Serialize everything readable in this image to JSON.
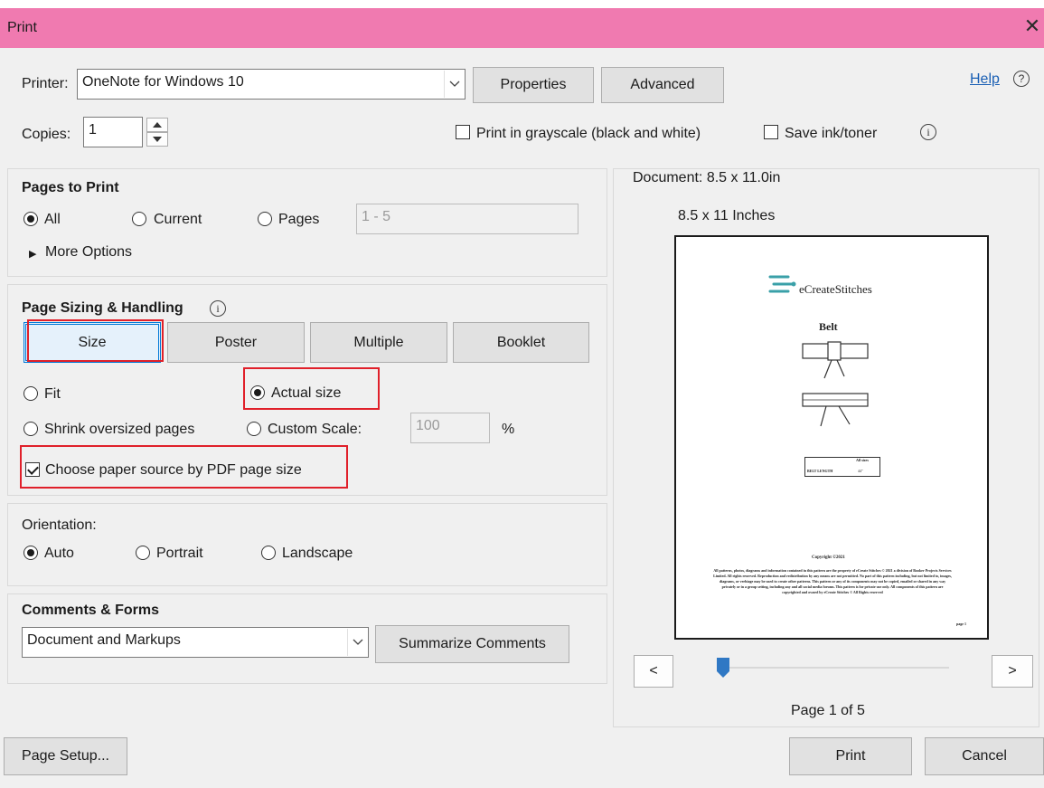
{
  "window": {
    "title": "Print",
    "close": "✕"
  },
  "top": {
    "printer_label": "Printer:",
    "printer_value": "OneNote for Windows 10",
    "properties": "Properties",
    "advanced": "Advanced",
    "help": "Help",
    "copies_label": "Copies:",
    "copies_value": "1",
    "grayscale_label": "Print in grayscale (black and white)",
    "grayscale_checked": false,
    "save_ink_label": "Save ink/toner",
    "save_ink_checked": false
  },
  "pages_to_print": {
    "heading": "Pages to Print",
    "all": "All",
    "current": "Current",
    "pages": "Pages",
    "selected": "All",
    "pages_range": "1 - 5",
    "more_options": "More Options"
  },
  "sizing": {
    "heading": "Page Sizing & Handling",
    "tabs": [
      "Size",
      "Poster",
      "Multiple",
      "Booklet"
    ],
    "active_tab": "Size",
    "fit": "Fit",
    "actual_size": "Actual size",
    "shrink": "Shrink oversized pages",
    "custom_scale": "Custom Scale:",
    "scale_value": "100",
    "percent": "%",
    "selected": "Actual size",
    "paper_source": "Choose paper source by PDF page size",
    "paper_source_checked": true
  },
  "orientation": {
    "label": "Orientation:",
    "auto": "Auto",
    "portrait": "Portrait",
    "landscape": "Landscape",
    "selected": "Auto"
  },
  "comments": {
    "heading": "Comments & Forms",
    "value": "Document and Markups",
    "summarize": "Summarize Comments"
  },
  "preview": {
    "document": "Document: 8.5 x 11.0in",
    "size_label": "8.5 x 11 Inches",
    "logo_text": "eCreateStitches",
    "item_title": "Belt",
    "table_header": "All sizes",
    "table_row_label": "BELT LENGTH",
    "table_row_value": "44\"",
    "copyright_title": "Copyright ©2021",
    "copyright_body": "All patterns, photos, diagrams and information contained in this pattern are the property of eCreate Stitches © 2021 a division of Booker Projects Services Limited. All rights reserved. Reproduction and redistribution by any means are not permitted. No part of this pattern including, but not limited to, images, diagrams, or verbiage may be used to create other patterns. This pattern or any of its components may not be copied, emailed or shared in any way privately or in a group setting, including any and all social media forums. This pattern is for private use only. All components of this pattern are copyrighted and owned by eCreate Stitches © All Rights reserved",
    "page_no": "page 1",
    "prev": "<",
    "next": ">",
    "page_indicator": "Page 1 of 5",
    "slider_fraction": 0.0
  },
  "footer": {
    "page_setup": "Page Setup...",
    "print": "Print",
    "cancel": "Cancel"
  },
  "colors": {
    "titlebar": "#f07ab0",
    "highlight": "#e0202a",
    "slider": "#2f78c4"
  }
}
